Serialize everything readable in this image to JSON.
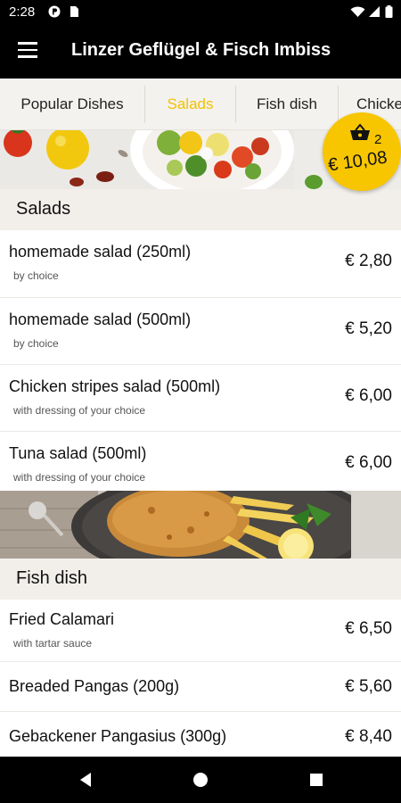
{
  "status_bar": {
    "time": "2:28",
    "icons": [
      "notification-icon",
      "sim-card-icon",
      "wifi-icon",
      "signal-icon",
      "battery-icon"
    ]
  },
  "app_bar": {
    "menu_icon": "hamburger-menu-icon",
    "title": "Linzer Geflügel & Fisch Imbiss"
  },
  "tabs": [
    {
      "label": "Popular Dishes",
      "active": false
    },
    {
      "label": "Salads",
      "active": true
    },
    {
      "label": "Fish dish",
      "active": false
    },
    {
      "label": "Chicke",
      "active": false
    }
  ],
  "cart": {
    "icon": "shopping-basket-icon",
    "count": "2",
    "total": "€ 10,08"
  },
  "sections": [
    {
      "title": "Salads",
      "items": [
        {
          "name": "homemade salad (250ml)",
          "desc": "by choice",
          "price": "€ 2,80"
        },
        {
          "name": "homemade salad (500ml)",
          "desc": "by choice",
          "price": "€ 5,20"
        },
        {
          "name": "Chicken stripes salad (500ml)",
          "desc": "with dressing of your choice",
          "price": "€ 6,00"
        },
        {
          "name": "Tuna salad (500ml)",
          "desc": "with dressing of your choice",
          "price": "€ 6,00"
        }
      ]
    },
    {
      "title": "Fish dish",
      "items": [
        {
          "name": "Fried Calamari",
          "desc": "with tartar sauce",
          "price": "€ 6,50"
        },
        {
          "name": "Breaded Pangas (200g)",
          "desc": "",
          "price": "€ 5,60"
        },
        {
          "name": "Gebackener Pangasius (300g)",
          "desc": "",
          "price": "€ 8,40"
        }
      ]
    }
  ],
  "colors": {
    "accent": "#f7c600",
    "active_tab": "#f2c200",
    "app_bar": "#000000",
    "section_bg": "#f2efeb"
  },
  "nav_bar": {
    "icons": [
      "back-icon",
      "home-icon",
      "recents-icon"
    ]
  }
}
